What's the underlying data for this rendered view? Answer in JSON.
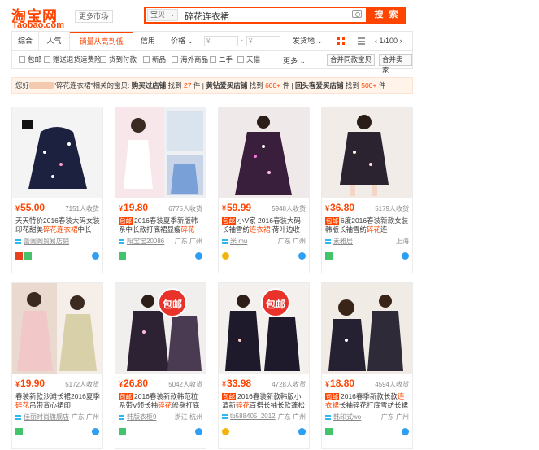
{
  "header": {
    "logo_cn": "淘宝网",
    "logo_en": "Taobao.com",
    "market_label": "更多市场",
    "search_type": "宝贝",
    "search_query": "碎花连衣裙",
    "search_button": "搜 索"
  },
  "sortbar": {
    "tabs": [
      "综合",
      "人气",
      "销量从高到低",
      "信用",
      "价格"
    ],
    "price_min_placeholder": "¥",
    "price_max_placeholder": "¥",
    "dash": "-",
    "ship_from": "发货地",
    "page": "1/100"
  },
  "filters": {
    "checks": [
      "包邮",
      "赠送退货运费险",
      "货到付款",
      "新品",
      "海外商品",
      "二手",
      "天猫"
    ],
    "more": "更多",
    "merge_shop": "合并同款宝贝",
    "merge_seller": "合并卖家"
  },
  "notice": {
    "prefix": "您好",
    "query_part": "\"碎花连衣裙\"相关的宝贝:",
    "s1_label": "购买过店铺",
    "s1_mid": " 找到 ",
    "s1_count": "27",
    "s1_suffix": " 件",
    "s2_label": "黄钻爱买店铺",
    "s2_mid": " 找到 ",
    "s2_count": "600+",
    "s2_suffix": " 件",
    "s3_label": "回头客爱买店铺",
    "s3_mid": " 找到 ",
    "s3_count": "500+",
    "s3_suffix": " 件"
  },
  "products": [
    {
      "currency": "¥",
      "price": "55.00",
      "sold": "7151人收货",
      "tag": "",
      "title_a": "天天特价2016春装大码女装印花甜美",
      "kw": "碎花连衣裙",
      "title_b": "中长",
      "shop": "蕾阑阁贸易店铺",
      "loc": ""
    },
    {
      "currency": "¥",
      "price": "19.80",
      "sold": "6775人收货",
      "tag": "包邮",
      "title_a": "2016春装夏季新版韩系中长款打底裙显瘦",
      "kw": "碎花",
      "title_b": "",
      "shop": "阳宝宝20086",
      "loc": "广东 广州"
    },
    {
      "currency": "¥",
      "price": "59.99",
      "sold": "5948人收货",
      "tag": "包邮",
      "title_a": "小V家 2016春装大码长袖雪纺",
      "kw": "连衣裙",
      "title_b": " 荷叶边收",
      "shop": "米 mu",
      "loc": "广东 广州"
    },
    {
      "currency": "¥",
      "price": "36.80",
      "sold": "5179人收货",
      "tag": "包邮",
      "title_a": "6度2016春装新款女装韩版长袖雪纺",
      "kw": "碎花",
      "title_b": "连",
      "shop": "素雅居",
      "loc": "上海"
    },
    {
      "currency": "¥",
      "price": "19.90",
      "sold": "5172人收货",
      "tag": "",
      "title_a": "春装新款沙滩长裙2016夏季",
      "kw": "碎花",
      "title_b": "吊带背心裙印",
      "shop": "佳丽时尚旗舰店",
      "loc": "广东 广州"
    },
    {
      "currency": "¥",
      "price": "26.80",
      "sold": "5042人收货",
      "tag": "包邮",
      "title_a": "2016春装新款韩范粒系带V领长袖",
      "kw": "碎花",
      "title_b": "修身打底mm雪纺",
      "shop": "韩版衣柜9",
      "loc": "浙江 杭州"
    },
    {
      "currency": "¥",
      "price": "33.98",
      "sold": "4728人收货",
      "tag": "包邮",
      "title_a": "2016春装新款韩版小清新",
      "kw": "碎花",
      "title_b": "百搭长袖长款蓬松显",
      "shop": "tb588405_2012",
      "loc": "广东 广州"
    },
    {
      "currency": "¥",
      "price": "18.80",
      "sold": "4594人收货",
      "tag": "包邮",
      "title_a": "2016春季新款长款",
      "kw": "连衣裙",
      "title_b": "长袖碎花打底雪纺长裙",
      "shop": "韩印式wo",
      "loc": "广东 广州"
    }
  ],
  "promo_badge": "包邮",
  "colors": {
    "accent": "#ff4400",
    "price": "#ff4400",
    "notice_bg": "#fff3ea"
  }
}
